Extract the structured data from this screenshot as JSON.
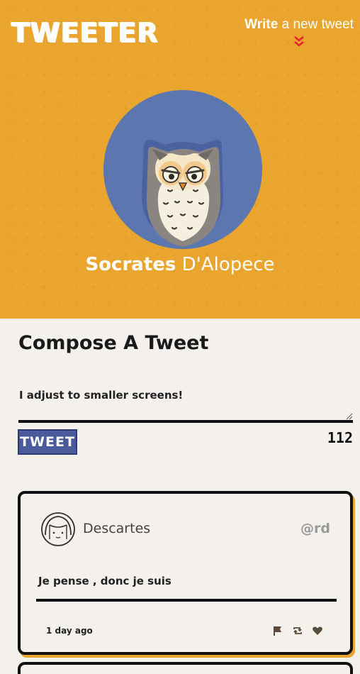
{
  "header": {
    "logo": "TWEETER",
    "write_bold": "Write",
    "write_rest": " a new tweet",
    "colors": {
      "hero_bg": "#e9a52d",
      "accent_chevron": "#e3262a"
    }
  },
  "profile": {
    "first_name": "Socrates",
    "last_name": " D'Alopece",
    "avatar_icon": "owl-avatar-icon",
    "avatar_bg": "#5c76b0"
  },
  "compose": {
    "title": "Compose A Tweet",
    "text_value": "I adjust to smaller screens!",
    "button_label": "TWEET",
    "char_counter": "112",
    "button_color": "#4a5b9c"
  },
  "tweets": [
    {
      "author": "Descartes",
      "handle": "@rd",
      "text": "Je pense , donc je suis",
      "time": "1 day ago",
      "actions": [
        "flag-icon",
        "retweet-icon",
        "heart-icon"
      ]
    }
  ]
}
